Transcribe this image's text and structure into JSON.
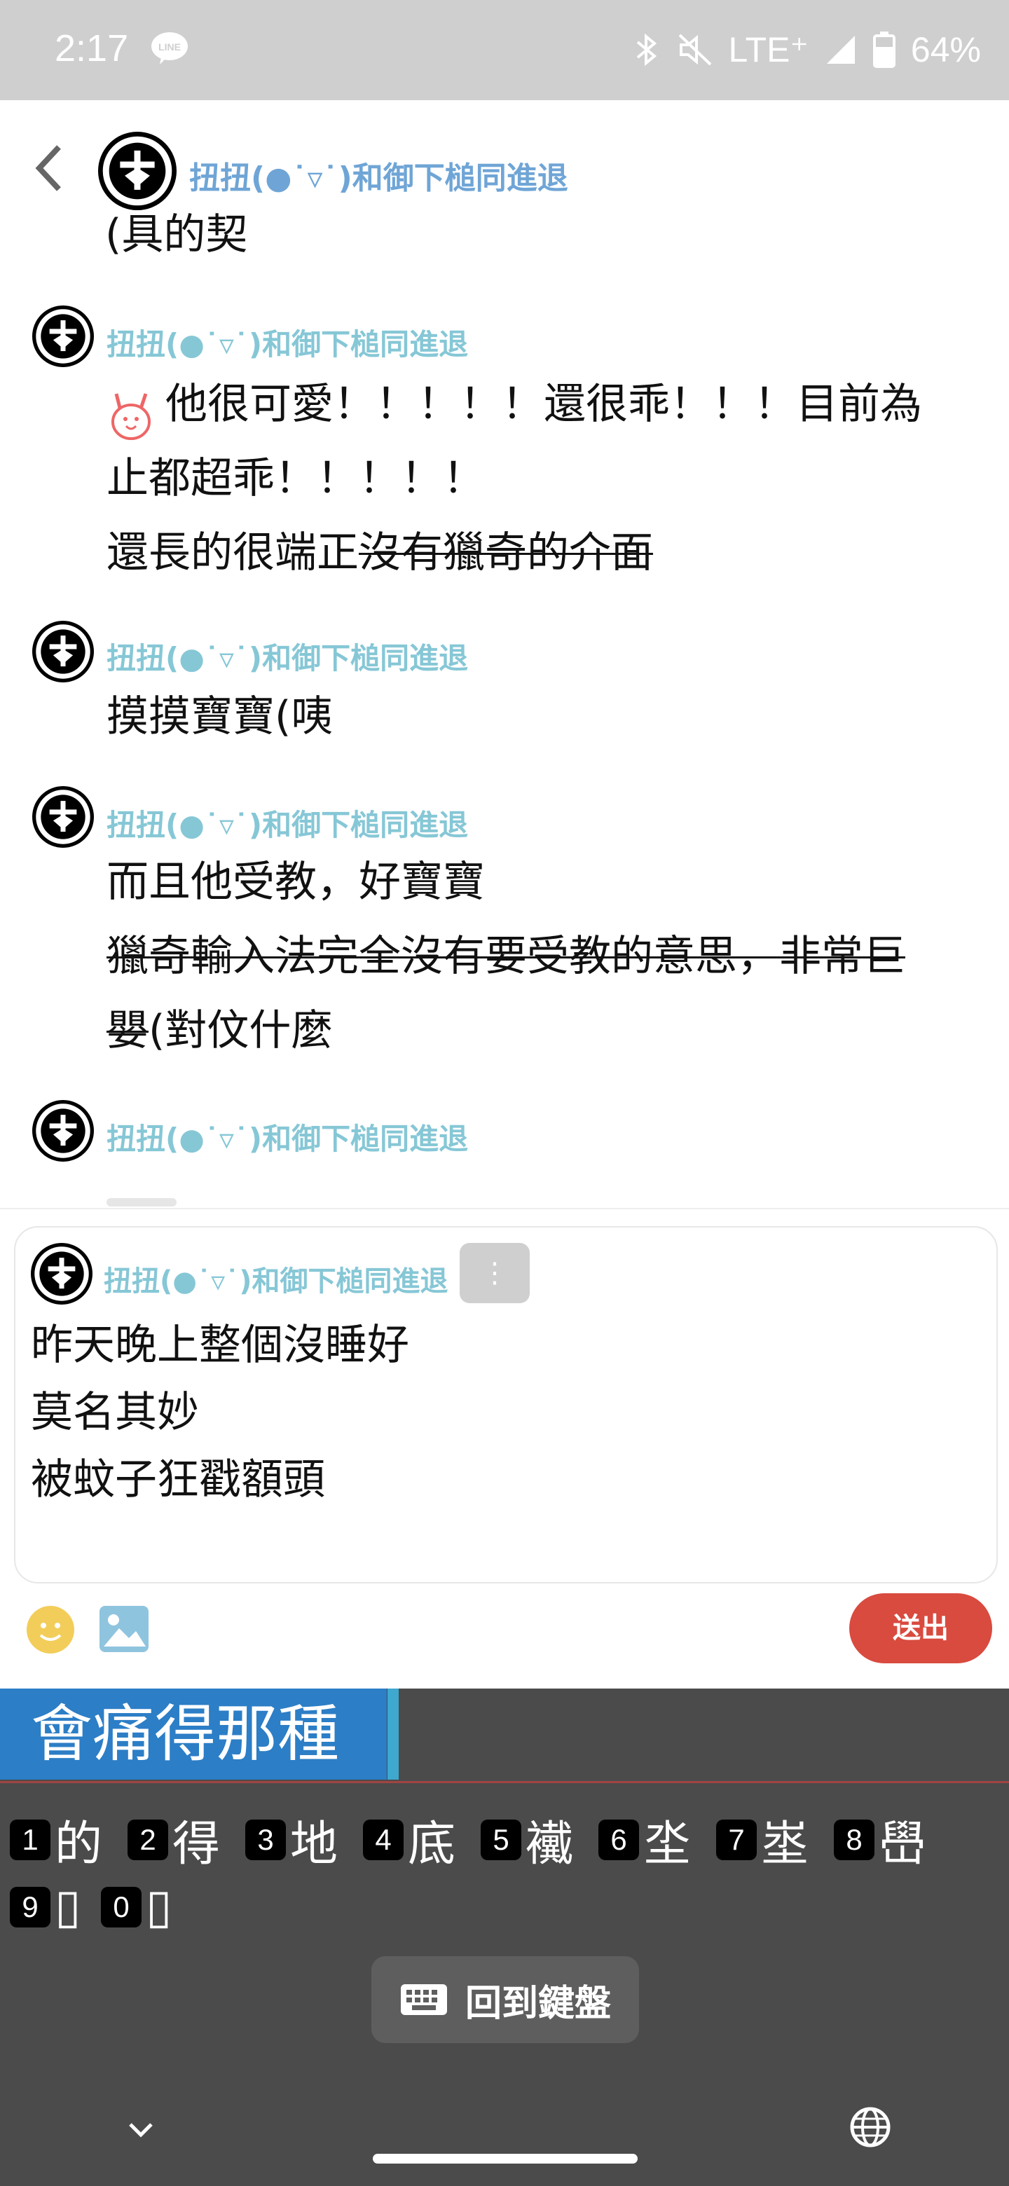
{
  "status": {
    "time": "2:17",
    "network": "LTE⁺",
    "battery": "64%"
  },
  "header": {
    "title": "扭扭(●˙▿˙)和御下槌同進退"
  },
  "messages": [
    {
      "sender": "扭扭(●˙▿˙)和御下槌同進退",
      "lines": [
        "他很可愛！！！！！還很乖！！！目前為",
        "止都超乖！！！！！"
      ],
      "strike_prefix": "還長的很端正",
      "strike_text": "沒有獵奇的介面"
    },
    {
      "sender": "扭扭(●˙▿˙)和御下槌同進退",
      "lines": [
        "摸摸寶寶(咦"
      ]
    },
    {
      "sender": "扭扭(●˙▿˙)和御下槌同進退",
      "lines": [
        "而且他受教，好寶寶"
      ],
      "strike_lines": [
        "獵奇輸入法完全沒有要受教的意思，非常巨"
      ],
      "after": "嬰(對伩什麼"
    },
    {
      "sender": "扭扭(●˙▿˙)和御下槌同進退"
    }
  ],
  "partial_top": "(具的契",
  "composer": {
    "sender": "扭扭(●˙▿˙)和御下槌同進退",
    "menu_label": "⋮",
    "lines": [
      "昨天晚上整個沒睡好",
      "莫名其妙",
      "被蚊子狂戳額頭"
    ],
    "send_label": "送出"
  },
  "ime": {
    "composing": "會痛得那種",
    "candidates": [
      {
        "n": "1",
        "c": "的"
      },
      {
        "n": "2",
        "c": "得"
      },
      {
        "n": "3",
        "c": "地"
      },
      {
        "n": "4",
        "c": "底"
      },
      {
        "n": "5",
        "c": "襶"
      },
      {
        "n": "6",
        "c": "坔"
      },
      {
        "n": "7",
        "c": "埊"
      },
      {
        "n": "8",
        "c": "嶨"
      },
      {
        "n": "9",
        "c": "▯"
      },
      {
        "n": "0",
        "c": "▯"
      }
    ],
    "back_label": "回到鍵盤"
  },
  "colors": {
    "send": "#d94a3f",
    "sender": "#86c7d6",
    "ime_bg": "#4b4b4b",
    "composing_bg": "#2c7ec6"
  }
}
